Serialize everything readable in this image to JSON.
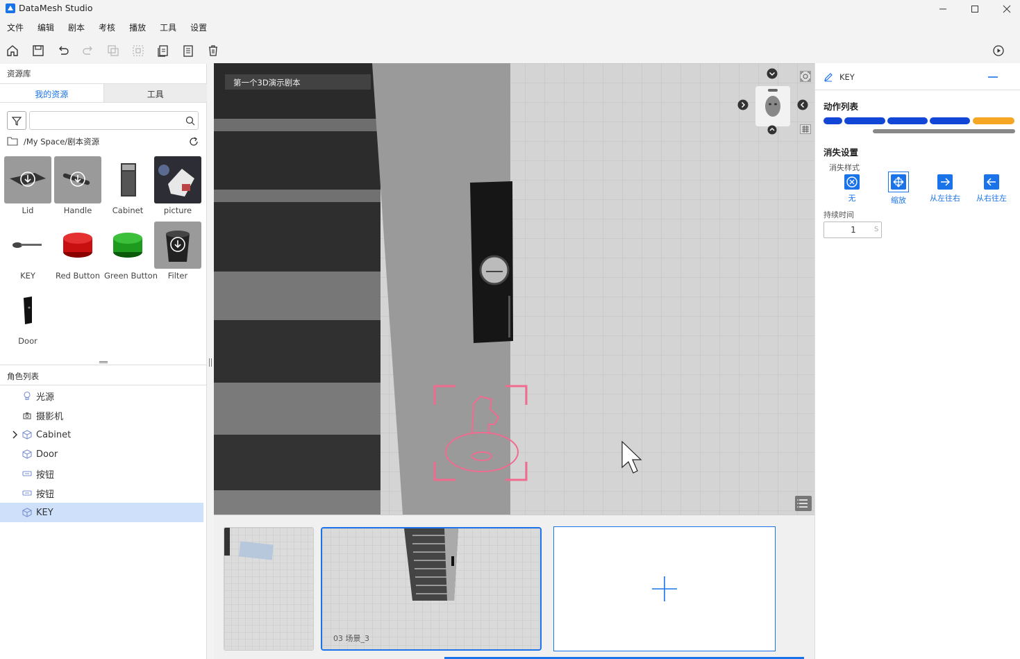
{
  "app": {
    "title": "DataMesh Studio"
  },
  "menu": [
    "文件",
    "编辑",
    "剧本",
    "考核",
    "播放",
    "工具",
    "设置"
  ],
  "left": {
    "library_title": "资源库",
    "tabs": {
      "mine": "我的资源",
      "tools": "工具"
    },
    "search": {
      "placeholder": ""
    },
    "path": "/My Space/剧本资源",
    "assets": [
      "Lid",
      "Handle",
      "Cabinet",
      "picture",
      "KEY",
      "Red Button",
      "Green Button",
      "Filter",
      "Door"
    ],
    "roles_title": "角色列表",
    "roles": [
      "光源",
      "摄影机",
      "Cabinet",
      "Door",
      "按钮",
      "按钮",
      "KEY"
    ]
  },
  "viewport": {
    "script_name": "第一个3D演示剧本"
  },
  "strip": {
    "scene2_label": "03   场景_3"
  },
  "right": {
    "object_name": "KEY",
    "action_list_title": "动作列表",
    "action_colors": [
      "#1246d6",
      "#1246d6",
      "#1246d6",
      "#1246d6",
      "#f5a623"
    ],
    "disappear_title": "消失设置",
    "style_label": "消失样式",
    "effects": [
      "无",
      "缩放",
      "从左往右",
      "从右往左"
    ],
    "duration_label": "持续时间",
    "duration_value": "1",
    "duration_unit": "S"
  },
  "colors": {
    "accent": "#1a73e8",
    "selection": "#cfe0fb",
    "marker": "#f06b8f"
  }
}
